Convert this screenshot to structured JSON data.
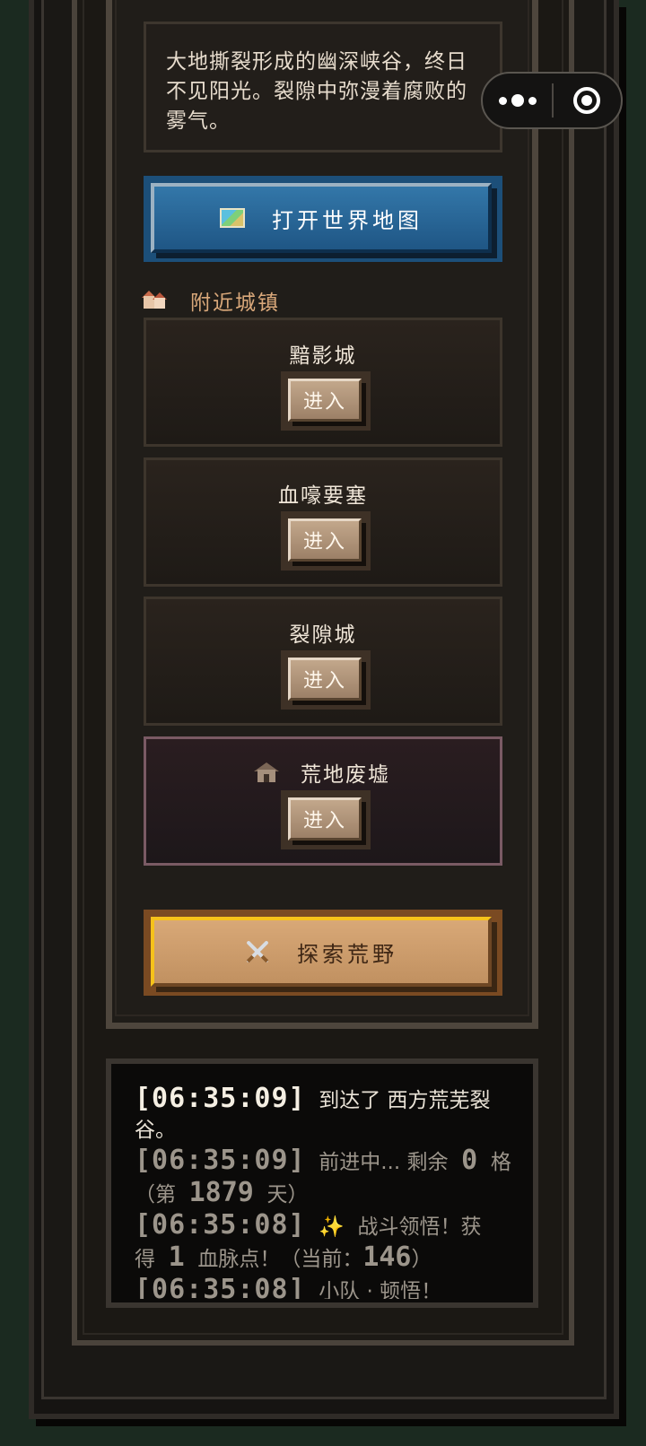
{
  "location": {
    "description": "大地撕裂形成的幽深峡谷，终日不见阳光。裂隙中弥漫着腐败的雾气。"
  },
  "map_button": {
    "label": "打开世界地图",
    "icon": "map-icon"
  },
  "nearby": {
    "title": "附近城镇",
    "icon": "houses-icon",
    "towns": [
      {
        "name": "黯影城",
        "enter_label": "进入"
      },
      {
        "name": "血嚎要塞",
        "enter_label": "进入"
      },
      {
        "name": "裂隙城",
        "enter_label": "进入"
      }
    ],
    "special": {
      "name": "荒地废墟",
      "enter_label": "进入",
      "icon": "derelict-house-icon"
    }
  },
  "explore_button": {
    "label": "探索荒野",
    "icon": "crossed-swords-icon"
  },
  "log": [
    {
      "time": "[06:35:09]",
      "text": "到达了 西方荒芜裂谷。"
    },
    {
      "time": "[06:35:09]",
      "pre": "前进中...",
      "remain_label": "剩余",
      "remain": "0",
      "unit": "格（第",
      "day": "1879",
      "day_suffix": "天）"
    },
    {
      "time": "[06:35:08]",
      "sparkle": "✨",
      "text1": "战斗领悟！获得",
      "points": "1",
      "text2": "血脉点！（当前：",
      "current": "146",
      "text3": "）"
    },
    {
      "time": "[06:35:08]",
      "text": "小队 · 顿悟！"
    }
  ],
  "colors": {
    "accent_blue": "#2a6a9a",
    "accent_gold": "#f6c21a",
    "text_tan": "#d9a87a"
  }
}
